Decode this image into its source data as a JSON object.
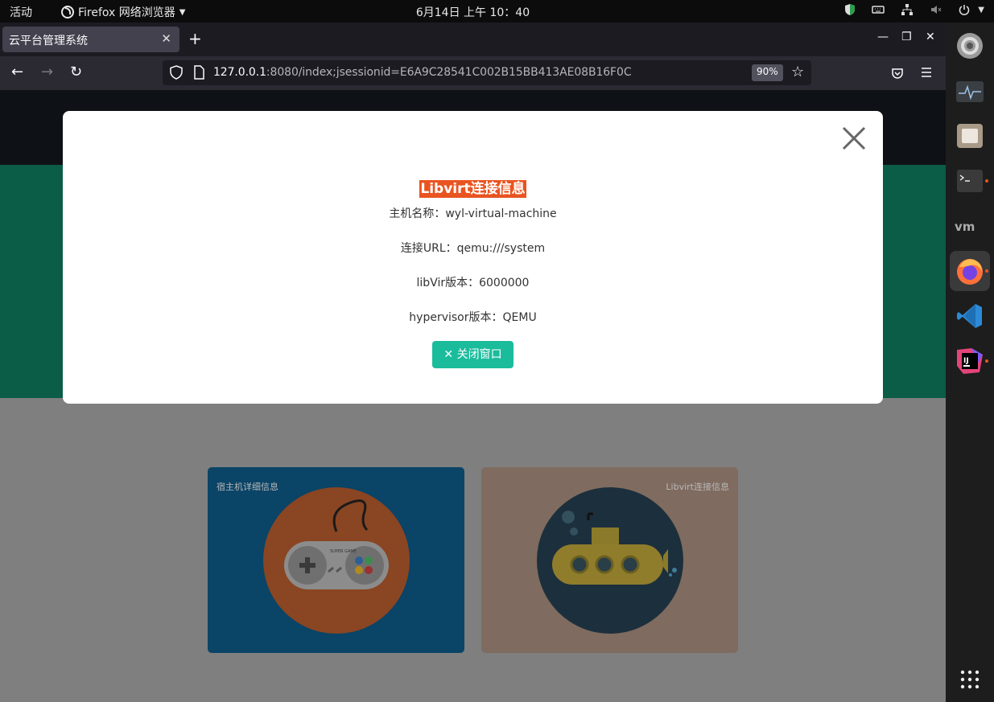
{
  "topbar": {
    "activities": "活动",
    "app_name": "Firefox 网络浏览器",
    "clock": "6月14日 上午 10：40"
  },
  "browser": {
    "tab_title": "云平台管理系统",
    "url_host": "127.0.0.1",
    "url_rest": ":8080/index;jsessionid=E6A9C28541C002B15BB413AE08B16F0C",
    "zoom": "90%"
  },
  "cards": [
    {
      "title": "宿主机详细信息"
    },
    {
      "title": "Libvirt连接信息"
    }
  ],
  "modal": {
    "title": "Libvirt连接信息",
    "host_line": "主机名称：wyl-virtual-machine",
    "url_line": "连接URL：qemu:///system",
    "version_line": "libVir版本：6000000",
    "hypervisor_line": "hypervisor版本：QEMU",
    "close_button": "关闭窗口"
  },
  "dock": {
    "items": [
      "settings-icon",
      "system-monitor-icon",
      "files-icon",
      "terminal-icon",
      "vmware-icon",
      "firefox-icon",
      "vscode-icon",
      "intellij-icon",
      "app-grid-icon"
    ]
  },
  "colors": {
    "modal_title_bg": "#e95420",
    "button_bg": "#1abc9c",
    "hero_bg": "#0b5d47"
  }
}
